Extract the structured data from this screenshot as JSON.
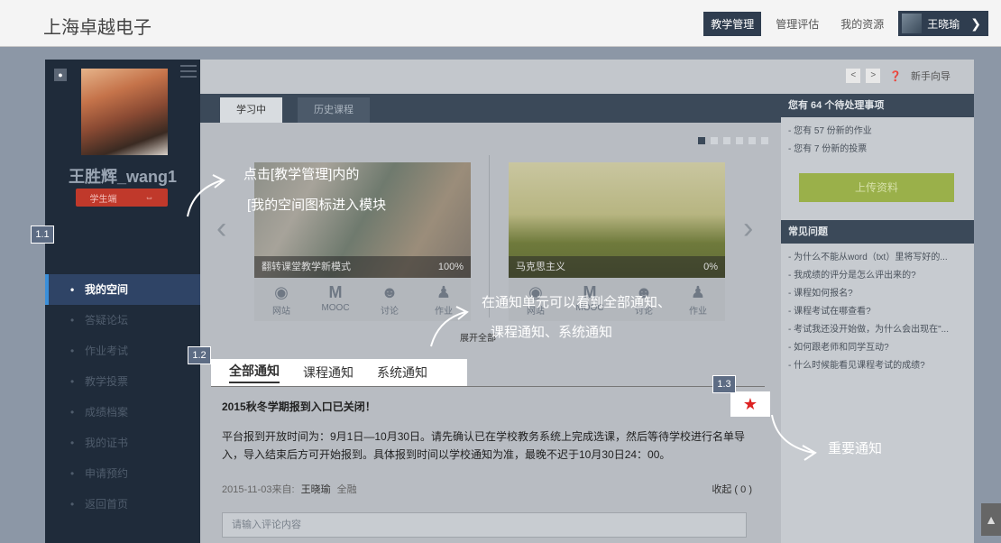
{
  "topbar": {
    "brand": "上海卓越电子",
    "nav": [
      "教学管理",
      "管理评估",
      "我的资源"
    ],
    "user": "王晓瑜"
  },
  "sidebar": {
    "name": "王胜辉_wang1",
    "role": "学生端",
    "items": [
      "我的空间",
      "答疑论坛",
      "作业考试",
      "教学投票",
      "成绩档案",
      "我的证书",
      "申请预约",
      "返回首页"
    ]
  },
  "pager": {
    "prev": "<",
    "next": ">",
    "guide": "新手向导"
  },
  "tabs": [
    "学习中",
    "历史课程"
  ],
  "courses": [
    {
      "title": "翻转课堂教学新模式",
      "progress": "100%"
    },
    {
      "title": "马克思主义",
      "progress": "0%"
    }
  ],
  "course_icons": [
    "网站",
    "MOOC",
    "讨论",
    "作业"
  ],
  "expand_text": "展开全部",
  "notice_tabs": [
    "全部通知",
    "课程通知",
    "系统通知"
  ],
  "notice": {
    "title": "2015秋冬学期报到入口已关闭！",
    "body": "平台报到开放时间为：9月1日—10月30日。请先确认已在学校教务系统上完成选课，然后等待学校进行名单导入，导入结束后方可开始报到。具体报到时间以学校通知为准，最晚不迟于10月30日24：00。",
    "date": "2015-11-03来自:",
    "author": "王晓瑜",
    "scope": "全融",
    "fav": "收起 ( 0 )",
    "comment_placeholder": "请输入评论内容"
  },
  "right": {
    "pending_title": "您有 64 个待处理事项",
    "pending": [
      "- 您有 57 份新的作业",
      "- 您有 7 份新的投票"
    ],
    "upload": "上传资料",
    "faq_title": "常见问题",
    "faq": [
      "- 为什么不能从word（txt）里将写好的...",
      "- 我成绩的评分是怎么评出来的?",
      "- 课程如何报名?",
      "- 课程考试在哪查看?",
      "- 考试我还没开始做，为什么会出现在\"...",
      "- 如何跟老师和同学互动?",
      "- 什么时候能看见课程考试的成绩?"
    ]
  },
  "annotations": {
    "a11": "1.1",
    "a12": "1.2",
    "a13": "1.3",
    "text1_line1": "点击[教学管理]内的",
    "text1_line2": "[我的空间图标进入模块",
    "text2_line1": "在通知单元可以看到全部通知、",
    "text2_line2": "课程通知、系统通知",
    "text3": "重要通知"
  },
  "colors": {
    "sidebar": "#1f2b3a",
    "accent_red": "#c0392b",
    "upload_green": "#9ab04a"
  }
}
